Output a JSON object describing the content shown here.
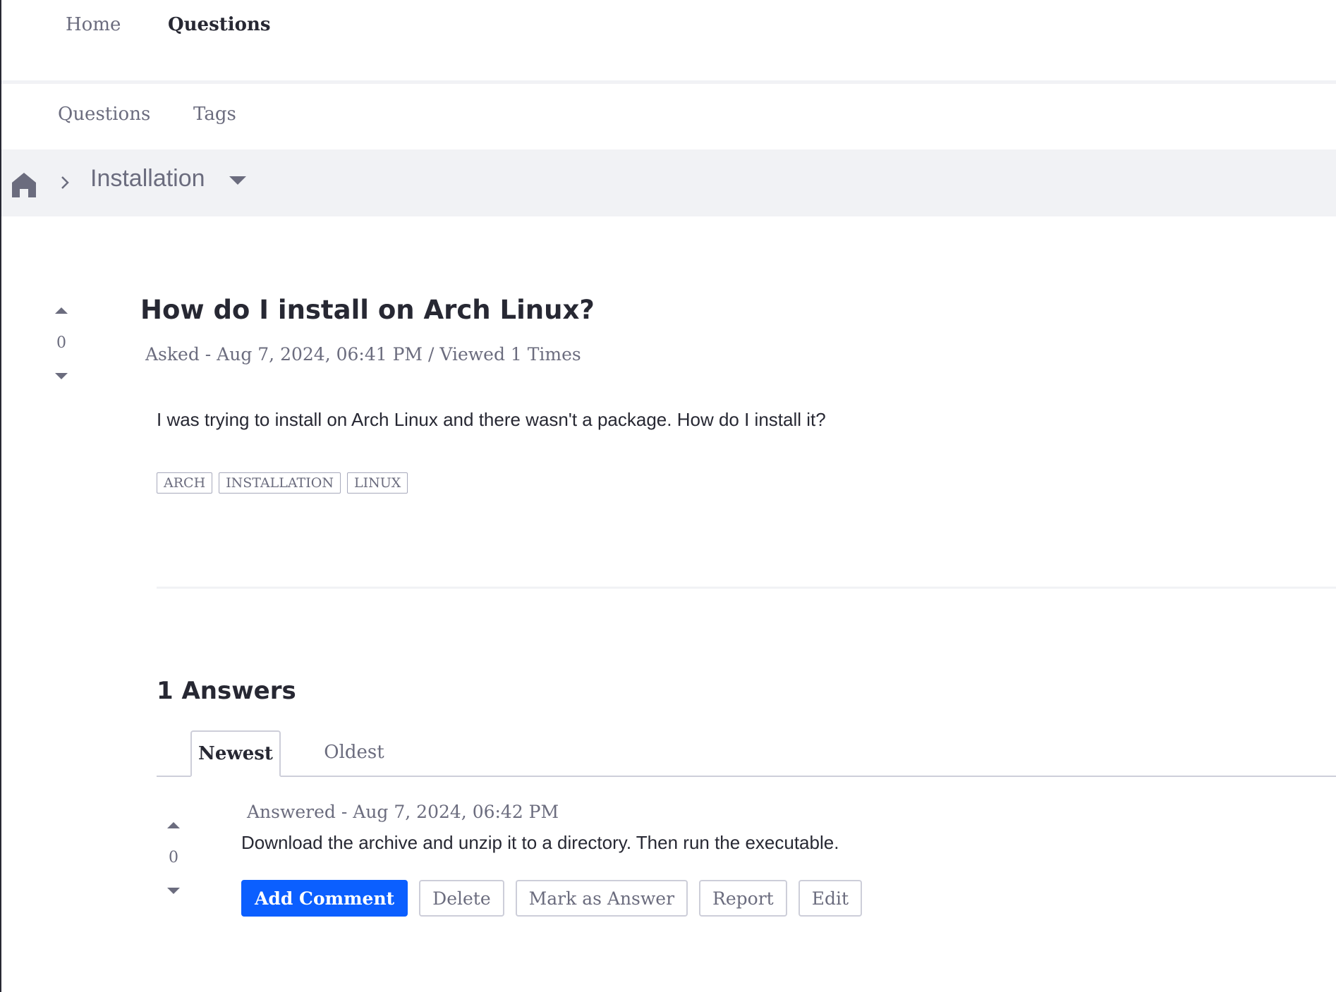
{
  "topnav": {
    "home": "Home",
    "questions": "Questions"
  },
  "subnav": {
    "questions": "Questions",
    "tags": "Tags"
  },
  "breadcrumb": {
    "current": "Installation"
  },
  "question": {
    "votes": "0",
    "title": "How do I install on Arch Linux?",
    "meta_asked": "Asked - Aug 7, 2024, 06:41 PM",
    "meta_sep": " / ",
    "meta_viewed": "Viewed 1 Times",
    "body": "I was trying to install on Arch Linux and there wasn't a package. How do I install it?",
    "tags": [
      "ARCH",
      "INSTALLATION",
      "LINUX"
    ]
  },
  "answers": {
    "title": "1 Answers",
    "tabs": [
      "Newest",
      "Oldest"
    ],
    "items": [
      {
        "votes": "0",
        "meta": "Answered - Aug 7, 2024, 06:42 PM",
        "body": "Download the archive and unzip it to a directory. Then run the executable.",
        "actions": {
          "add_comment": "Add Comment",
          "delete": "Delete",
          "mark_answer": "Mark as Answer",
          "report": "Report",
          "edit": "Edit"
        }
      }
    ]
  },
  "icons": {
    "home": "home-icon",
    "chevron": "chevron-right-icon",
    "caret": "caret-down-icon",
    "vote_up": "caret-up-icon",
    "vote_down": "caret-down-icon"
  },
  "colors": {
    "accent": "#0b5fff",
    "text": "#272833",
    "muted": "#6b6c7e",
    "breadcrumb_bg": "#f1f2f5"
  }
}
